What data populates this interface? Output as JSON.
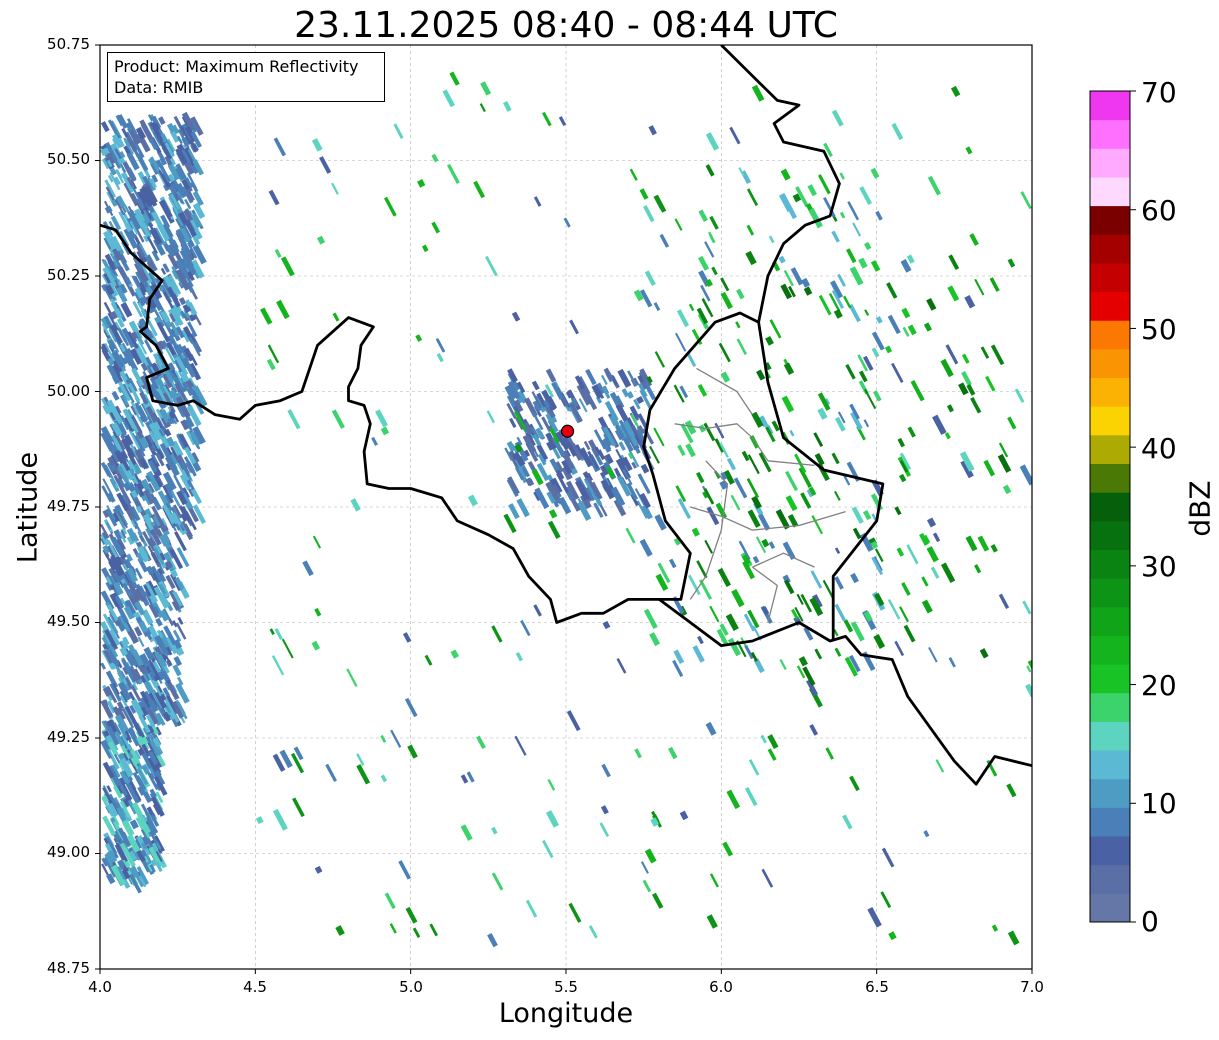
{
  "title": "23.11.2025 08:40 - 08:44 UTC",
  "info": {
    "product": "Product: Maximum Reflectivity",
    "data": "Data: RMIB"
  },
  "axes": {
    "xlabel": "Longitude",
    "ylabel": "Latitude",
    "xlim": [
      4.0,
      7.0
    ],
    "ylim": [
      48.75,
      50.75
    ],
    "xticks": [
      "4.0",
      "4.5",
      "5.0",
      "5.5",
      "6.0",
      "6.5",
      "7.0"
    ],
    "yticks": [
      "50.75",
      "50.50",
      "50.25",
      "50.00",
      "49.75",
      "49.50",
      "49.25",
      "49.00",
      "48.75"
    ],
    "grid": true
  },
  "colorbar": {
    "label": "dBZ",
    "ticks": [
      "0",
      "10",
      "20",
      "30",
      "40",
      "50",
      "60",
      "70"
    ],
    "colors": [
      "#6477a6",
      "#5a6fa5",
      "#4a62a3",
      "#4a80b7",
      "#4e9bc3",
      "#5cb9d4",
      "#5dd4c0",
      "#3dd36c",
      "#18c425",
      "#14b41e",
      "#10a419",
      "#0d9416",
      "#0a8312",
      "#08710f",
      "#06600b",
      "#4a7a05",
      "#adaa04",
      "#fbd303",
      "#fbb203",
      "#fb9403",
      "#fb7903",
      "#e50000",
      "#c40000",
      "#a40000",
      "#7a0000",
      "#ffd8ff",
      "#ffaaff",
      "#ff70ff",
      "#ee37ee"
    ]
  },
  "marker": {
    "lon": 5.505,
    "lat": 49.914,
    "color": "#e3000f"
  },
  "borders": {
    "thick": [
      [
        [
          4.0,
          50.36
        ],
        [
          4.05,
          50.35
        ],
        [
          4.1,
          50.3
        ],
        [
          4.15,
          50.27
        ],
        [
          4.2,
          50.24
        ],
        [
          4.16,
          50.2
        ],
        [
          4.15,
          50.14
        ],
        [
          4.13,
          50.13
        ],
        [
          4.18,
          50.1
        ],
        [
          4.22,
          50.05
        ],
        [
          4.15,
          50.03
        ],
        [
          4.17,
          49.98
        ],
        [
          4.25,
          49.97
        ],
        [
          4.3,
          49.98
        ],
        [
          4.37,
          49.95
        ],
        [
          4.45,
          49.94
        ],
        [
          4.5,
          49.97
        ],
        [
          4.58,
          49.98
        ],
        [
          4.65,
          50.0
        ],
        [
          4.7,
          50.1
        ],
        [
          4.75,
          50.13
        ],
        [
          4.8,
          50.16
        ],
        [
          4.88,
          50.14
        ],
        [
          4.84,
          50.1
        ],
        [
          4.83,
          50.05
        ],
        [
          4.8,
          50.01
        ],
        [
          4.8,
          49.98
        ],
        [
          4.85,
          49.97
        ],
        [
          4.87,
          49.93
        ],
        [
          4.85,
          49.87
        ],
        [
          4.86,
          49.8
        ],
        [
          4.93,
          49.79
        ],
        [
          5.0,
          49.79
        ],
        [
          5.05,
          49.78
        ],
        [
          5.1,
          49.77
        ],
        [
          5.15,
          49.72
        ],
        [
          5.25,
          49.69
        ],
        [
          5.33,
          49.66
        ],
        [
          5.38,
          49.6
        ],
        [
          5.45,
          49.55
        ],
        [
          5.47,
          49.5
        ],
        [
          5.55,
          49.52
        ],
        [
          5.62,
          49.52
        ],
        [
          5.7,
          49.55
        ],
        [
          5.8,
          49.55
        ],
        [
          5.87,
          49.55
        ],
        [
          5.9,
          49.65
        ],
        [
          5.82,
          49.72
        ],
        [
          5.78,
          49.82
        ],
        [
          5.75,
          49.88
        ],
        [
          5.77,
          49.96
        ],
        [
          5.85,
          50.05
        ],
        [
          5.98,
          50.15
        ],
        [
          6.06,
          50.17
        ],
        [
          6.12,
          50.15
        ],
        [
          6.15,
          50.25
        ],
        [
          6.2,
          50.32
        ],
        [
          6.27,
          50.36
        ],
        [
          6.35,
          50.38
        ],
        [
          6.38,
          50.45
        ],
        [
          6.33,
          50.52
        ],
        [
          6.2,
          50.54
        ],
        [
          6.17,
          50.58
        ],
        [
          6.25,
          50.62
        ],
        [
          6.18,
          50.63
        ],
        [
          6.12,
          50.67
        ],
        [
          6.0,
          50.75
        ]
      ],
      [
        [
          5.8,
          49.55
        ],
        [
          5.9,
          49.5
        ],
        [
          6.0,
          49.45
        ],
        [
          6.1,
          49.46
        ],
        [
          6.25,
          49.5
        ],
        [
          6.35,
          49.46
        ],
        [
          6.4,
          49.47
        ],
        [
          6.45,
          49.43
        ],
        [
          6.55,
          49.42
        ],
        [
          6.6,
          49.34
        ],
        [
          6.75,
          49.2
        ],
        [
          6.82,
          49.15
        ],
        [
          6.88,
          49.21
        ],
        [
          7.0,
          49.19
        ]
      ],
      [
        [
          6.12,
          50.15
        ],
        [
          6.15,
          50.02
        ],
        [
          6.2,
          49.9
        ],
        [
          6.33,
          49.83
        ],
        [
          6.52,
          49.8
        ],
        [
          6.5,
          49.72
        ],
        [
          6.43,
          49.66
        ],
        [
          6.36,
          49.6
        ],
        [
          6.36,
          49.46
        ]
      ]
    ],
    "thin": [
      [
        [
          5.85,
          49.93
        ],
        [
          5.95,
          49.92
        ],
        [
          6.05,
          49.93
        ],
        [
          6.1,
          49.9
        ],
        [
          6.15,
          49.85
        ],
        [
          6.3,
          49.84
        ]
      ],
      [
        [
          5.9,
          49.75
        ],
        [
          6.0,
          49.73
        ],
        [
          6.1,
          49.7
        ],
        [
          6.25,
          49.71
        ],
        [
          6.4,
          49.74
        ]
      ],
      [
        [
          5.95,
          49.85
        ],
        [
          6.02,
          49.8
        ],
        [
          6.0,
          49.7
        ],
        [
          5.95,
          49.6
        ],
        [
          5.9,
          49.55
        ]
      ],
      [
        [
          6.1,
          49.62
        ],
        [
          6.2,
          49.65
        ],
        [
          6.3,
          49.62
        ]
      ],
      [
        [
          6.15,
          49.5
        ],
        [
          6.18,
          49.58
        ],
        [
          6.1,
          49.62
        ]
      ],
      [
        [
          5.92,
          50.05
        ],
        [
          6.05,
          50.0
        ],
        [
          6.1,
          49.95
        ]
      ]
    ]
  }
}
